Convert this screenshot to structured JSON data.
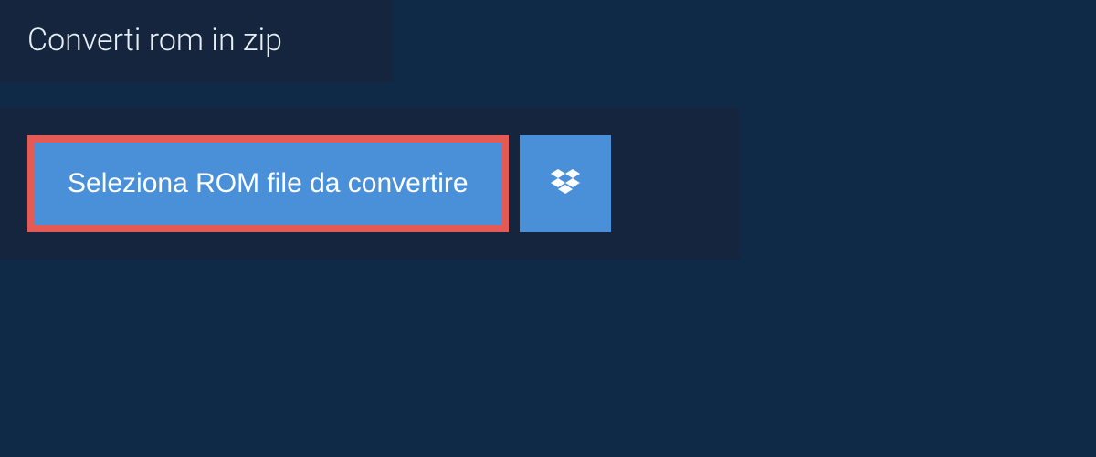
{
  "header": {
    "title": "Converti rom in zip"
  },
  "actions": {
    "select_file_label": "Seleziona ROM file da convertire",
    "dropbox_icon_name": "dropbox"
  },
  "colors": {
    "background": "#0e2a47",
    "panel": "#14253d",
    "button": "#4a90d9",
    "highlight_border": "#e45a54",
    "text_light": "#ffffff"
  }
}
